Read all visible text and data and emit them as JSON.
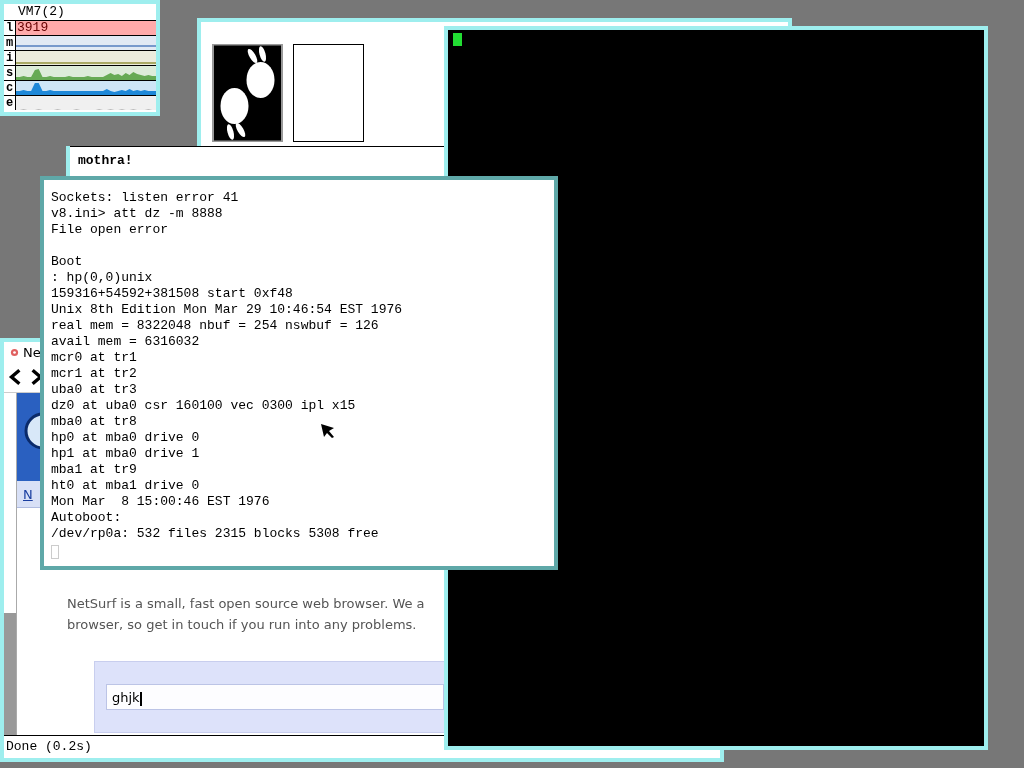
{
  "stats": {
    "title": "VM7(2)",
    "rows": [
      {
        "label": "l",
        "kind": "reading",
        "value": "3919",
        "color": "#ffaaaa"
      },
      {
        "label": "m",
        "kind": "line",
        "color": "#7799cc"
      },
      {
        "label": "i",
        "kind": "line",
        "color": "#aaaa66"
      },
      {
        "label": "s",
        "kind": "graph",
        "color": "#66aa55"
      },
      {
        "label": "c",
        "kind": "graph",
        "color": "#1e88d8"
      },
      {
        "label": "e",
        "kind": "graph",
        "color": "#bbbbbb"
      }
    ]
  },
  "viewer": {
    "cards": [
      {
        "kind": "picture"
      },
      {
        "kind": "blank"
      }
    ]
  },
  "mothra": {
    "text": "mothra!"
  },
  "browser": {
    "title": "Ne",
    "header_link": "N",
    "paragraph": [
      "NetSurf is a small, fast open source web browser. We a",
      "browser, so get in touch if you run into any problems."
    ],
    "search": {
      "value": "ghjk"
    },
    "status": "Done (0.2s)"
  },
  "console": {
    "blocks": [
      [
        "Sockets: listen error 41",
        "v8.ini> att dz -m 8888",
        "File open error"
      ],
      [
        "Boot",
        ": hp(0,0)unix",
        "159316+54592+381508 start 0xf48",
        "Unix 8th Edition Mon Mar 29 10:46:54 EST 1976",
        "real mem = 8322048 nbuf = 254 nswbuf = 126",
        "avail mem = 6316032",
        "mcr0 at tr1",
        "mcr1 at tr2",
        "uba0 at tr3",
        "dz0 at uba0 csr 160100 vec 0300 ipl x15",
        "mba0 at tr8",
        "hp0 at mba0 drive 0",
        "hp1 at mba0 drive 1",
        "mba1 at tr9",
        "ht0 at mba1 drive 0",
        "Mon Mar  8 15:00:46 EST 1976",
        "Autoboot:",
        "/dev/rp0a: 532 files 2315 blocks 5308 free"
      ]
    ]
  }
}
